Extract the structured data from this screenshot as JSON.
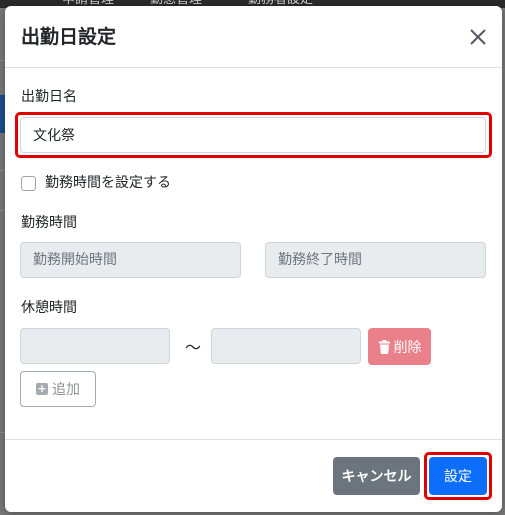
{
  "background": {
    "nav_items": [
      "申請管理",
      "勤怠管理",
      "勤務者設定"
    ]
  },
  "modal": {
    "title": "出勤日設定",
    "close_icon": "close-icon"
  },
  "form": {
    "workday_name_label": "出勤日名",
    "workday_name_value": "文化祭",
    "set_hours_checkbox_label": "勤務時間を設定する",
    "set_hours_checked": false,
    "work_hours_label": "勤務時間",
    "work_start_placeholder": "勤務開始時間",
    "work_end_placeholder": "勤務終了時間",
    "break_time_label": "休憩時間",
    "break_separator": "〜",
    "delete_label": "削除",
    "add_label": "追加"
  },
  "footer": {
    "cancel_label": "キャンセル",
    "submit_label": "設定"
  },
  "colors": {
    "primary": "#0d6efd",
    "secondary": "#6c757d",
    "danger_disabled": "#e9808a",
    "highlight": "#e00000"
  }
}
